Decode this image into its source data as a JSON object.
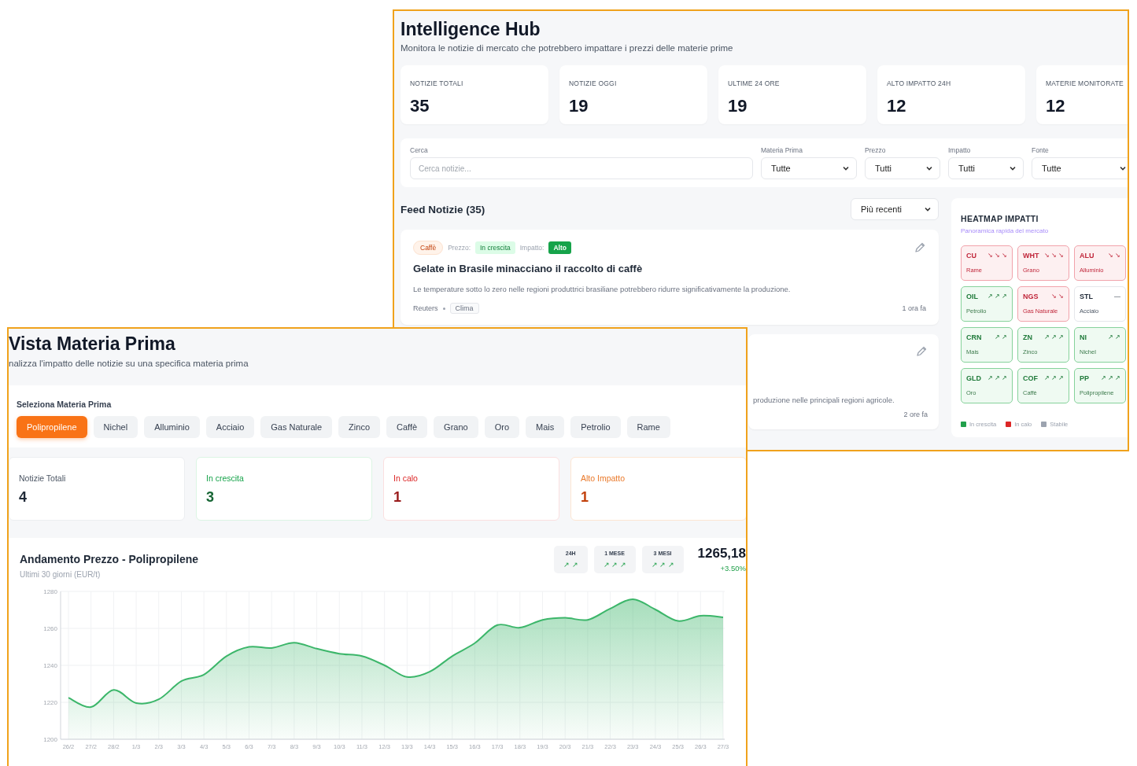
{
  "hub_window": {
    "title": "Intelligence Hub",
    "subtitle": "Monitora le notizie di mercato che potrebbero impattare i prezzi delle materie prime",
    "stats": [
      {
        "label": "NOTIZIE TOTALI",
        "value": "35"
      },
      {
        "label": "NOTIZIE OGGI",
        "value": "19"
      },
      {
        "label": "ULTIME 24 ORE",
        "value": "19"
      },
      {
        "label": "ALTO IMPATTO 24H",
        "value": "12"
      },
      {
        "label": "MATERIE MONITORATE",
        "value": "12"
      }
    ],
    "filters": {
      "search": {
        "label": "Cerca",
        "placeholder": "Cerca notizie..."
      },
      "selects": [
        {
          "label": "Materia Prima",
          "value": "Tutte"
        },
        {
          "label": "Prezzo",
          "value": "Tutti"
        },
        {
          "label": "Impatto",
          "value": "Tutti"
        },
        {
          "label": "Fonte",
          "value": "Tutte"
        }
      ]
    },
    "feed": {
      "title": "Feed Notizie (35)",
      "sort": "Più recenti",
      "items": [
        {
          "tags": [
            {
              "kind": "commodity",
              "text": "Caffè"
            },
            {
              "kind": "label",
              "text": "Prezzo:"
            },
            {
              "kind": "rising",
              "text": "In crescita"
            },
            {
              "kind": "label",
              "text": "Impatto:"
            },
            {
              "kind": "high",
              "text": "Alto"
            }
          ],
          "title": "Gelate in Brasile minacciano il raccolto di caffè",
          "description": "Le temperature sotto lo zero nelle regioni produttrici brasiliane potrebbero ridurre significativamente la produzione.",
          "source": "Reuters",
          "category": "Clima",
          "time": "1 ora fa"
        },
        {
          "description": "produzione nelle principali regioni agricole.",
          "time": "2 ore fa"
        }
      ]
    },
    "heatmap": {
      "title": "HEATMAP IMPATTI",
      "subtitle": "Panoramica rapida del mercato",
      "cells": [
        {
          "code": "CU",
          "arrows": "↘ ↘ ↘",
          "name": "Rame",
          "kind": "down"
        },
        {
          "code": "WHT",
          "arrows": "↘ ↘ ↘",
          "name": "Grano",
          "kind": "down"
        },
        {
          "code": "ALU",
          "arrows": "↘ ↘",
          "name": "Alluminio",
          "kind": "down"
        },
        {
          "code": "OIL",
          "arrows": "↗ ↗ ↗",
          "name": "Petrolio",
          "kind": "up"
        },
        {
          "code": "NGS",
          "arrows": "↘ ↘",
          "name": "Gas Naturale",
          "kind": "down"
        },
        {
          "code": "STL",
          "arrows": "—",
          "name": "Acciaio",
          "kind": "stable"
        },
        {
          "code": "CRN",
          "arrows": "↗ ↗",
          "name": "Mais",
          "kind": "up"
        },
        {
          "code": "ZN",
          "arrows": "↗ ↗ ↗",
          "name": "Zinco",
          "kind": "up"
        },
        {
          "code": "NI",
          "arrows": "↗ ↗",
          "name": "Nichel",
          "kind": "up"
        },
        {
          "code": "GLD",
          "arrows": "↗ ↗ ↗",
          "name": "Oro",
          "kind": "up"
        },
        {
          "code": "COF",
          "arrows": "↗ ↗ ↗",
          "name": "Caffè",
          "kind": "up"
        },
        {
          "code": "PP",
          "arrows": "↗ ↗ ↗",
          "name": "Polipropilene",
          "kind": "up"
        }
      ],
      "legend": [
        {
          "label": "In crescita",
          "color": "#22a04b"
        },
        {
          "label": "In calo",
          "color": "#dc2626"
        },
        {
          "label": "Stabile",
          "color": "#9ca3af"
        }
      ]
    }
  },
  "vista_window": {
    "title": "Vista Materia Prima",
    "subtitle": "nalizza l'impatto delle notizie su una specifica materia prima",
    "selector_label": "Seleziona Materia Prima",
    "chips": [
      {
        "label": "Polipropilene",
        "selected": true
      },
      {
        "label": "Nichel",
        "selected": false
      },
      {
        "label": "Alluminio",
        "selected": false
      },
      {
        "label": "Acciaio",
        "selected": false
      },
      {
        "label": "Gas Naturale",
        "selected": false
      },
      {
        "label": "Zinco",
        "selected": false
      },
      {
        "label": "Caffè",
        "selected": false
      },
      {
        "label": "Grano",
        "selected": false
      },
      {
        "label": "Oro",
        "selected": false
      },
      {
        "label": "Mais",
        "selected": false
      },
      {
        "label": "Petrolio",
        "selected": false
      },
      {
        "label": "Rame",
        "selected": false
      }
    ],
    "stats": [
      {
        "label": "Notizie Totali",
        "value": "4",
        "kind": "neutral"
      },
      {
        "label": "In crescita",
        "value": "3",
        "kind": "up"
      },
      {
        "label": "In calo",
        "value": "1",
        "kind": "down"
      },
      {
        "label": "Alto Impatto",
        "value": "1",
        "kind": "high"
      }
    ],
    "price_panel": {
      "title": "Andamento Prezzo - Polipropilene",
      "subtitle": "Ultimi 30 giorni (EUR/t)",
      "periods": [
        {
          "label": "24H",
          "arrows": "↗ ↗"
        },
        {
          "label": "1 MESE",
          "arrows": "↗ ↗ ↗"
        },
        {
          "label": "3 MESI",
          "arrows": "↗ ↗ ↗"
        }
      ],
      "price": "1265,18",
      "change": "+3.50%",
      "chart_data": {
        "type": "area",
        "grid": true,
        "categories": [
          "26/2",
          "27/2",
          "28/2",
          "1/3",
          "2/3",
          "3/3",
          "4/3",
          "5/3",
          "6/3",
          "7/3",
          "8/3",
          "9/3",
          "10/3",
          "11/3",
          "12/3",
          "13/3",
          "14/3",
          "15/3",
          "16/3",
          "17/3",
          "18/3",
          "19/3",
          "20/3",
          "21/3",
          "22/3",
          "23/3",
          "24/3",
          "25/3",
          "26/3",
          "27/3"
        ],
        "series": [
          {
            "color": "#3cb66a",
            "values": [
              1222.5,
              1217.4,
              1226.7,
              1219.6,
              1221.6,
              1231.4,
              1235,
              1245,
              1250,
              1249.4,
              1252.2,
              1249,
              1246.3,
              1245,
              1240,
              1233.7,
              1236.5,
              1245,
              1252,
              1261.8,
              1260.4,
              1264.6,
              1265.7,
              1264.6,
              1270.7,
              1275.8,
              1270.2,
              1264,
              1266.8,
              1266
            ]
          }
        ],
        "ylim": [
          1200,
          1280
        ],
        "yticks": [
          1200,
          1220,
          1240,
          1260,
          1280
        ]
      }
    }
  }
}
